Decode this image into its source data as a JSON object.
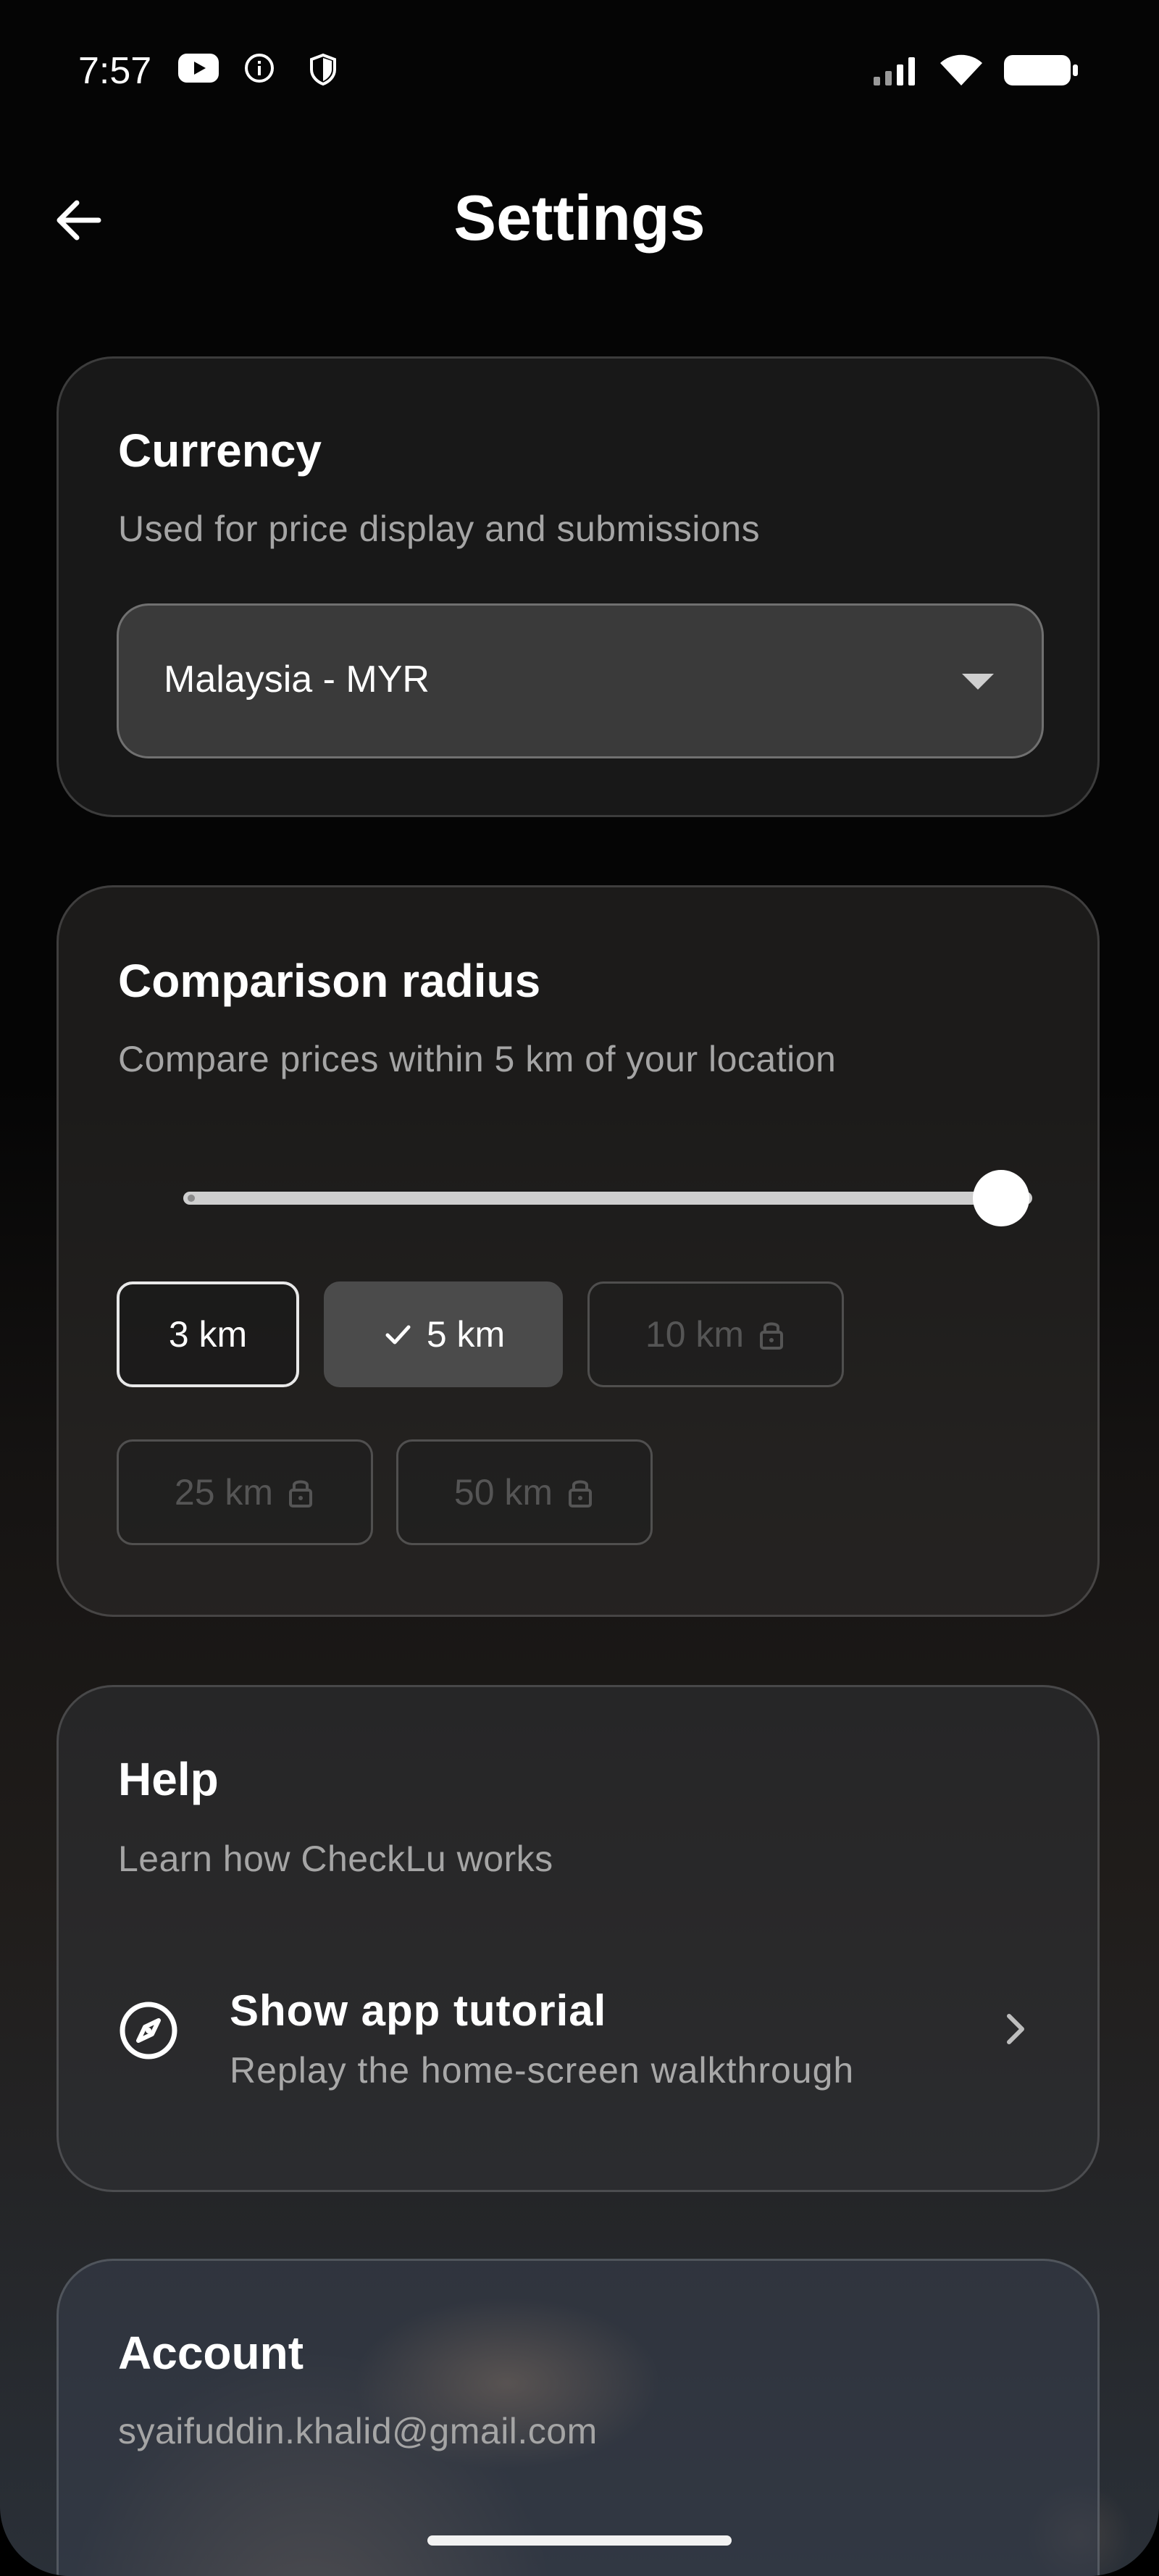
{
  "status_bar": {
    "time": "7:57",
    "icons": [
      "youtube-icon",
      "info-icon",
      "shield-icon",
      "signal-icon",
      "wifi-icon",
      "battery-icon"
    ]
  },
  "header": {
    "title": "Settings",
    "back_icon": "arrow-left-icon"
  },
  "currency": {
    "title": "Currency",
    "subtitle": "Used for price display and submissions",
    "selected": "Malaysia - MYR"
  },
  "radius": {
    "title": "Comparison radius",
    "subtitle": "Compare prices within 5 km of your location",
    "slider_value_fraction": 1.0,
    "options": [
      {
        "label": "3 km",
        "state": "outlined"
      },
      {
        "label": "5 km",
        "state": "selected"
      },
      {
        "label": "10 km",
        "state": "locked"
      },
      {
        "label": "25 km",
        "state": "locked"
      },
      {
        "label": "50 km",
        "state": "locked"
      }
    ]
  },
  "help": {
    "title": "Help",
    "subtitle": "Learn how CheckLu works",
    "tutorial": {
      "title": "Show app tutorial",
      "subtitle": "Replay the home-screen walkthrough",
      "icon": "compass-icon"
    }
  },
  "account": {
    "title": "Account",
    "email": "syaifuddin.khalid@gmail.com"
  },
  "colors": {
    "background": "#050505",
    "card_border": "#3a3a3a",
    "selected_chip": "#4b4b4b",
    "subtext": "#a5a5a5",
    "locked_text": "#555555"
  }
}
